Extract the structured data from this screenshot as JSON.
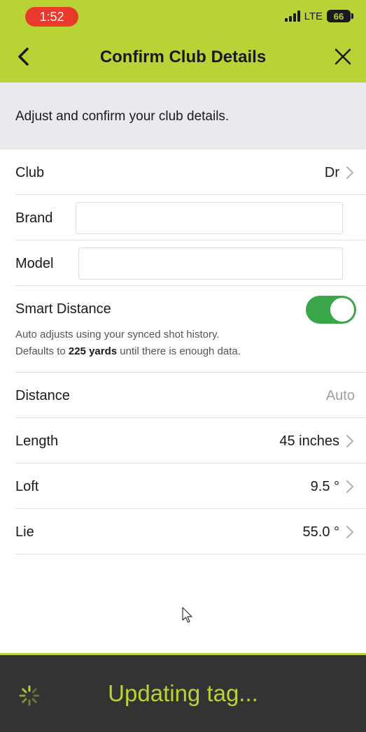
{
  "status_bar": {
    "time": "1:52",
    "network": "LTE",
    "battery": "66"
  },
  "nav": {
    "title": "Confirm Club Details"
  },
  "intro": {
    "text": "Adjust and confirm your club details."
  },
  "form": {
    "club": {
      "label": "Club",
      "value": "Dr"
    },
    "brand": {
      "label": "Brand",
      "value": "",
      "placeholder": ""
    },
    "model": {
      "label": "Model",
      "value": "",
      "placeholder": ""
    },
    "smart_distance": {
      "label": "Smart Distance",
      "enabled": true,
      "help_line1": "Auto adjusts using your synced shot history.",
      "help_line2_prefix": "Defaults to ",
      "help_line2_bold": "225 yards",
      "help_line2_suffix": " until there is enough data."
    },
    "distance": {
      "label": "Distance",
      "value": "Auto"
    },
    "length": {
      "label": "Length",
      "value": "45 inches"
    },
    "loft": {
      "label": "Loft",
      "value": "9.5 °"
    },
    "lie": {
      "label": "Lie",
      "value": "55.0 °"
    }
  },
  "toast": {
    "text": "Updating tag..."
  },
  "colors": {
    "accent": "#b8d335",
    "toggle_on": "#3aa64a",
    "status_pill": "#e8392c",
    "toast_bg": "#333333"
  }
}
